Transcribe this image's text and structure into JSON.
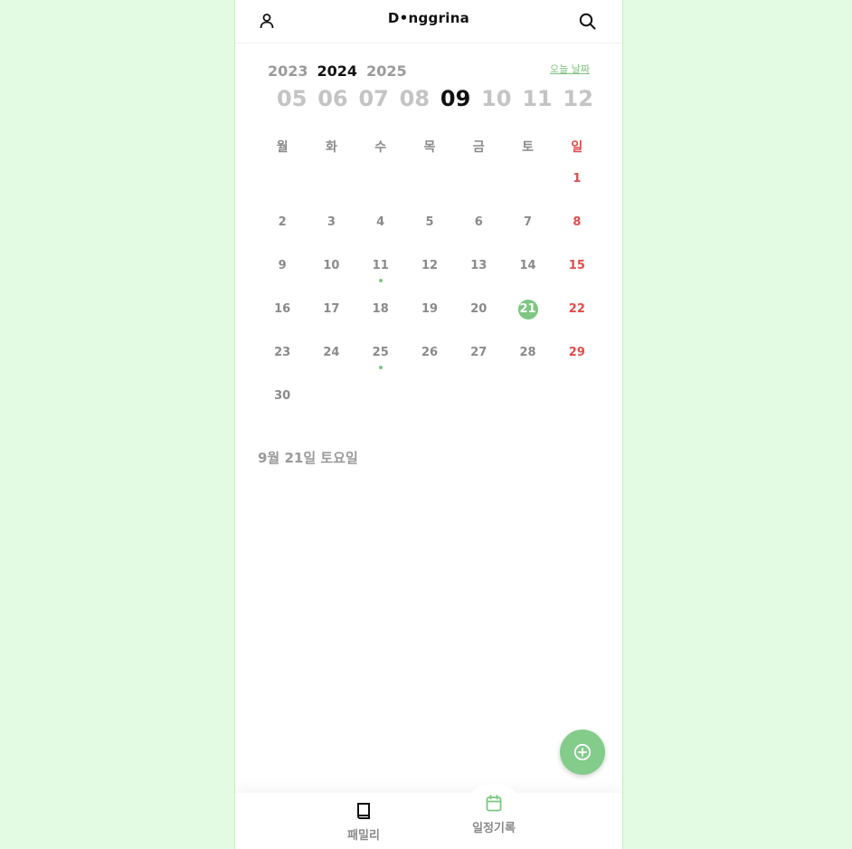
{
  "header": {
    "logo": "D•nggrina",
    "profile_icon": "user-icon",
    "search_icon": "search-icon"
  },
  "years": [
    "2023",
    "2024",
    "2025"
  ],
  "selected_year": "2024",
  "today_link": "오늘 날짜",
  "months": [
    "05",
    "06",
    "07",
    "08",
    "09",
    "10",
    "11",
    "12"
  ],
  "selected_month": "09",
  "weekdays": [
    "월",
    "화",
    "수",
    "목",
    "금",
    "토",
    "일"
  ],
  "calendar": {
    "leading_blanks": 6,
    "days": [
      "1",
      "2",
      "3",
      "4",
      "5",
      "6",
      "7",
      "8",
      "9",
      "10",
      "11",
      "12",
      "13",
      "14",
      "15",
      "16",
      "17",
      "18",
      "19",
      "20",
      "21",
      "22",
      "23",
      "24",
      "25",
      "26",
      "27",
      "28",
      "29",
      "30"
    ],
    "selected_day": "21",
    "event_days": [
      "11",
      "25"
    ]
  },
  "selected_date_label": "9월 21일 토요일",
  "fab": {
    "icon": "plus-circle-icon"
  },
  "bottom_nav": {
    "family": {
      "label": "패밀리",
      "icon": "book-icon"
    },
    "schedule": {
      "label": "일정기록",
      "icon": "calendar-icon"
    }
  },
  "colors": {
    "background": "#e4fbe3",
    "accent": "#7dc782",
    "sunday": "#e04d4d",
    "muted": "#8a8a8a"
  }
}
